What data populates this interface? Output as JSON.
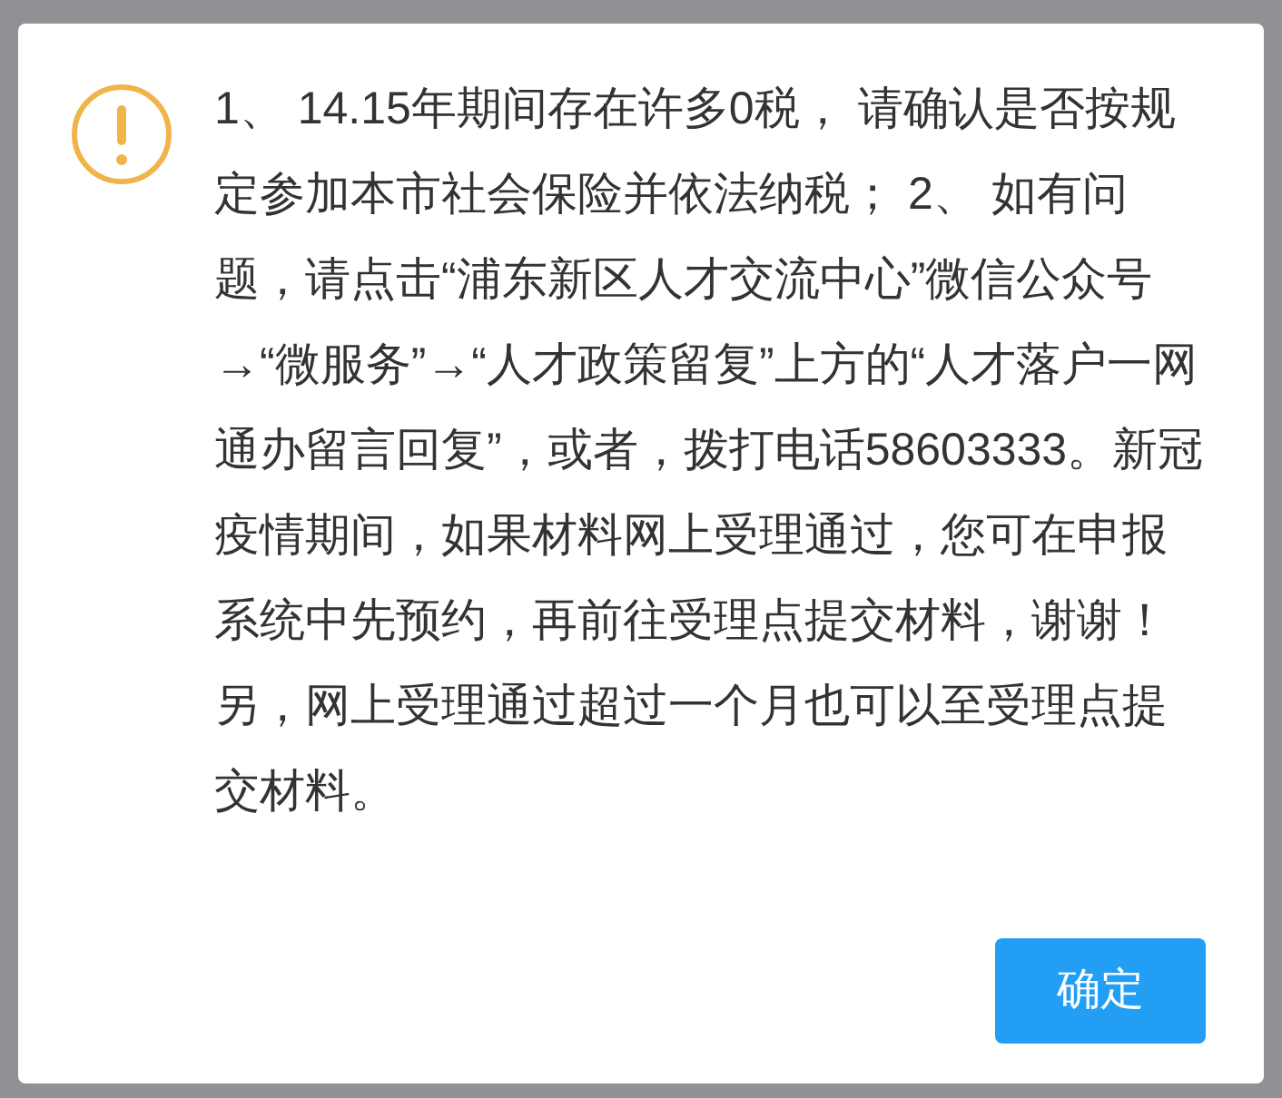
{
  "dialog": {
    "kind": "warning",
    "message": "1、 14.15年期间存在许多0税， 请确认是否按规定参加本市社会保险并依法纳税； 2、 如有问题，请点击“浦东新区人才交流中心”微信公众号→“微服务”→“人才政策留复”上方的“人才落户一网通办留言回复”，或者，拨打电话58603333。新冠疫情期间，如果材料网上受理通过，您可在申报系统中先预约，再前往受理点提交材料，谢谢！另，网上受理通过超过一个月也可以至受理点提交材料。",
    "buttons": [
      "确定"
    ]
  }
}
